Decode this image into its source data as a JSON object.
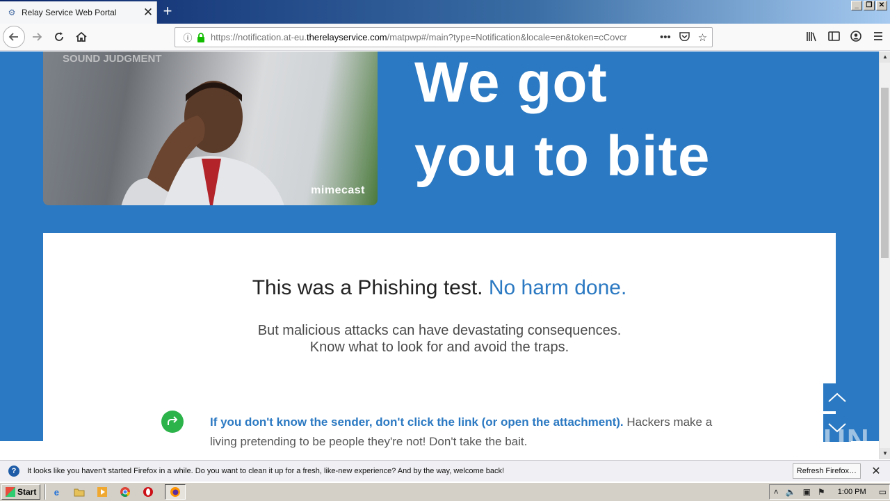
{
  "browser": {
    "tab_title": "Relay Service Web Portal",
    "tab_close": "✕",
    "new_tab": "+",
    "url_prefix": "https://notification.at-eu.",
    "url_domain": "therelayservice.com",
    "url_suffix": "/matpwp#/main?type=Notification&locale=en&token=cCovcr",
    "window_buttons": [
      "_",
      "❐",
      "✕"
    ]
  },
  "hero": {
    "photo_sign": "SOUND JUDGMENT",
    "logo": "mimecast",
    "headline_line1": "We got",
    "headline_line2": "you to bite"
  },
  "card": {
    "headline_main": "This was a Phishing test.",
    "headline_accent": "No harm done.",
    "sub_line1": "But malicious attacks can have devastating consequences.",
    "sub_line2": "Know what to look for and avoid the traps.",
    "tip_strong": "If you don't know the sender, don't click the link (or open the attachment).",
    "tip_text": "Hackers make a living pretending to be people they're not! Don't take the bait."
  },
  "watermark": "ANY RUN",
  "notification": {
    "text": "It looks like you haven't started Firefox in a while. Do you want to clean it up for a fresh, like-new experience? And by the way, welcome back!",
    "button": "Refresh Firefox…",
    "close": "✕"
  },
  "taskbar": {
    "start": "Start",
    "clock": "1:00 PM"
  },
  "colors": {
    "brand_blue": "#2b79c2",
    "tip_green": "#2cb34a"
  }
}
